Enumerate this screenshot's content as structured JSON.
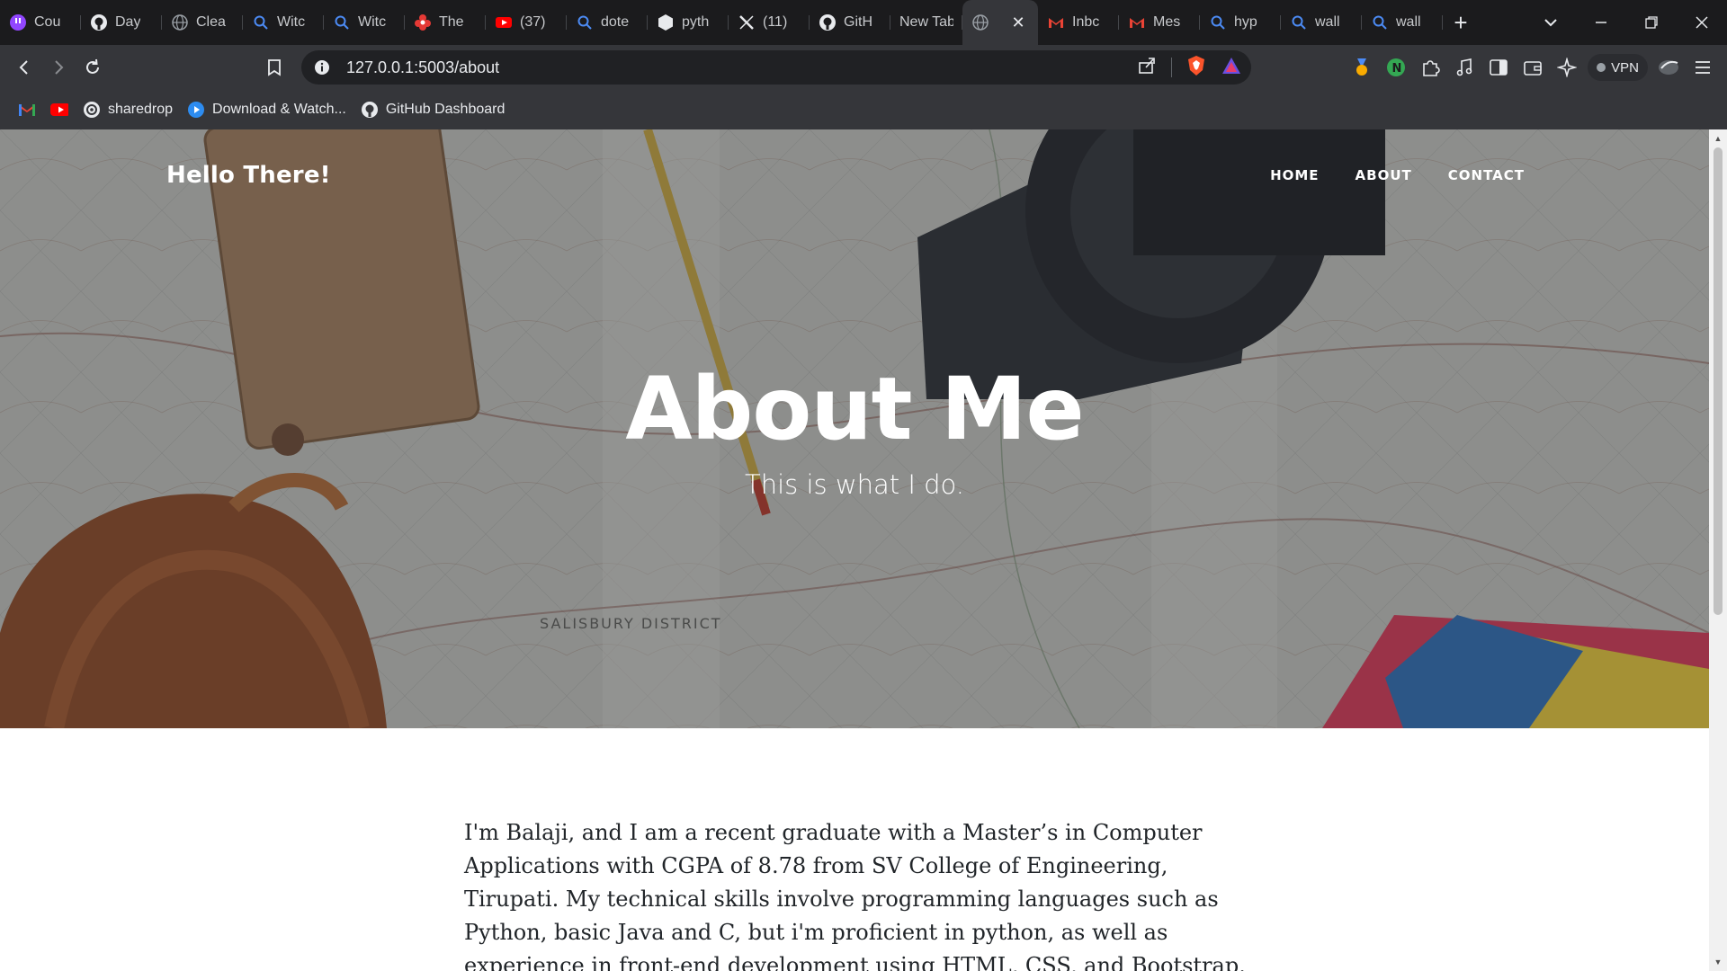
{
  "browser": {
    "tabs": [
      {
        "label": "Cou",
        "icon": "twitch-like-icon"
      },
      {
        "label": "Day",
        "icon": "github-icon"
      },
      {
        "label": "Clea",
        "icon": "globe-icon"
      },
      {
        "label": "Witc",
        "icon": "search-icon"
      },
      {
        "label": "Witc",
        "icon": "search-icon"
      },
      {
        "label": "The",
        "icon": "red-flower-icon"
      },
      {
        "label": "(37)",
        "icon": "youtube-icon"
      },
      {
        "label": "dote",
        "icon": "search-icon"
      },
      {
        "label": "pyth",
        "icon": "hexagon-icon"
      },
      {
        "label": "(11)",
        "icon": "x-icon"
      },
      {
        "label": "GitH",
        "icon": "github-icon"
      },
      {
        "label": "New Tab",
        "icon": ""
      },
      {
        "label": "",
        "icon": "globe-icon",
        "active": true
      },
      {
        "label": "Inbc",
        "icon": "gmail-icon"
      },
      {
        "label": "Mes",
        "icon": "gmail-icon"
      },
      {
        "label": "hyp",
        "icon": "search-icon"
      },
      {
        "label": "wall",
        "icon": "search-icon"
      },
      {
        "label": "wall",
        "icon": "search-icon"
      }
    ],
    "new_tab_symbol": "+",
    "url": "127.0.0.1:5003/about",
    "vpn_label": "VPN",
    "bookmarks": [
      {
        "label": "",
        "icon": "gmail-icon"
      },
      {
        "label": "",
        "icon": "youtube-icon"
      },
      {
        "label": "sharedrop",
        "icon": "sharedrop-icon"
      },
      {
        "label": "Download & Watch...",
        "icon": "play-icon"
      },
      {
        "label": "GitHub Dashboard",
        "icon": "github-icon"
      }
    ]
  },
  "page": {
    "brand": "Hello There!",
    "nav": {
      "home": "HOME",
      "about": "ABOUT",
      "contact": "CONTACT"
    },
    "hero_title": "About Me",
    "hero_subtitle": "This is what I do.",
    "body_text": "I'm Balaji, and I am a recent graduate with a Master’s in Computer Applications with CGPA of 8.78 from SV College of Engineering, Tirupati. My technical skills involve programming languages such as Python, basic Java and C, but i'm proficient in python, as well as experience in front-end development using HTML, CSS, and Bootstrap. On the back-end, I've"
  },
  "colors": {
    "tabstrip": "#1b1b1d",
    "toolbar": "#35363a",
    "omnibox": "#202124",
    "brave_orange": "#fb542b",
    "text_dark": "#212529"
  }
}
